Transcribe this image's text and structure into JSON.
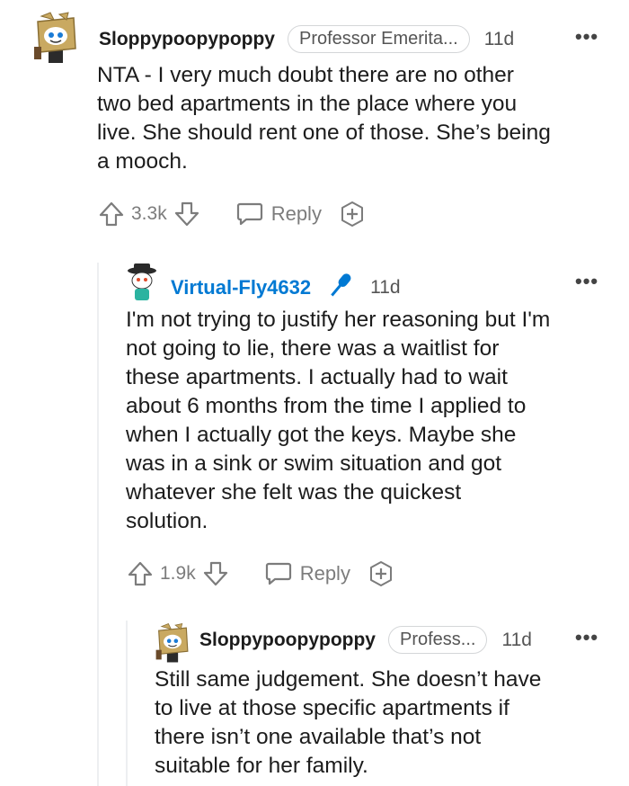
{
  "comments": [
    {
      "username": "Sloppypoopypoppy",
      "flair": "Professor Emerita...",
      "time": "11d",
      "more": "•••",
      "body_lines": [
        "NTA - I very much doubt there are no other",
        "two bed apartments in the place where you",
        "live. She should rent one of those. She’s being",
        "a mooch."
      ],
      "score": "3.3k",
      "reply_label": "Reply"
    },
    {
      "username": "Virtual-Fly4632",
      "time": "11d",
      "more": "•••",
      "body_lines": [
        "I'm not trying to justify her reasoning but I'm",
        "not going to lie, there was a waitlist for",
        "these apartments. I actually had to wait",
        "about 6 months from the time I applied to",
        "when I actually got the keys. Maybe she",
        "was in a sink or swim situation and got",
        "whatever she felt was the quickest",
        "solution."
      ],
      "score": "1.9k",
      "reply_label": "Reply"
    },
    {
      "username": "Sloppypoopypoppy",
      "flair": "Profess...",
      "time": "11d",
      "more": "•••",
      "body_lines": [
        "Still same judgement. She doesn’t have",
        "to live at those specific apartments if",
        "there isn’t one available that’s not",
        "suitable for her family."
      ]
    }
  ],
  "colors": {
    "username_blue": "#0079d3",
    "mic_blue": "#0079d3",
    "thread_line": "#edeff1",
    "muted": "#7c7c7c"
  },
  "icons": [
    "upvote-icon",
    "downvote-icon",
    "reply-bubble-icon",
    "award-icon",
    "microphone-icon",
    "more-icon"
  ]
}
